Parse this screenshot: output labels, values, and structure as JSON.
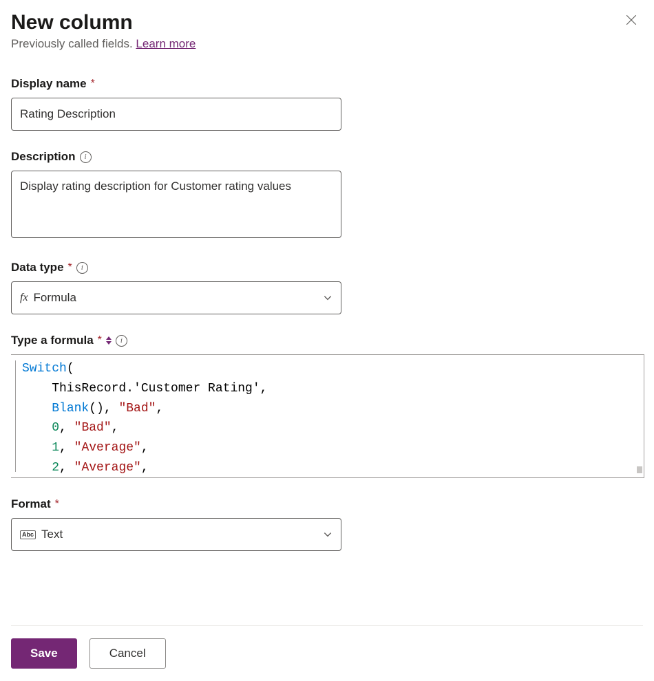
{
  "header": {
    "title": "New column",
    "subtitle_prefix": "Previously called fields. ",
    "learn_more": "Learn more"
  },
  "fields": {
    "display_name": {
      "label": "Display name",
      "value": "Rating Description"
    },
    "description": {
      "label": "Description",
      "value": "Display rating description for Customer rating values"
    },
    "data_type": {
      "label": "Data type",
      "icon": "fx",
      "value": "Formula"
    },
    "formula": {
      "label": "Type a formula",
      "code": [
        {
          "tokens": [
            {
              "cls": "tk-func",
              "t": "Switch"
            },
            {
              "cls": "tk-text",
              "t": "("
            }
          ]
        },
        {
          "tokens": [
            {
              "cls": "tk-text",
              "t": "    ThisRecord.'Customer Rating',"
            }
          ]
        },
        {
          "tokens": [
            {
              "cls": "tk-text",
              "t": "    "
            },
            {
              "cls": "tk-func",
              "t": "Blank"
            },
            {
              "cls": "tk-text",
              "t": "(), "
            },
            {
              "cls": "tk-str",
              "t": "\"Bad\""
            },
            {
              "cls": "tk-text",
              "t": ","
            }
          ]
        },
        {
          "tokens": [
            {
              "cls": "tk-text",
              "t": "    "
            },
            {
              "cls": "tk-num",
              "t": "0"
            },
            {
              "cls": "tk-text",
              "t": ", "
            },
            {
              "cls": "tk-str",
              "t": "\"Bad\""
            },
            {
              "cls": "tk-text",
              "t": ","
            }
          ]
        },
        {
          "tokens": [
            {
              "cls": "tk-text",
              "t": "    "
            },
            {
              "cls": "tk-num",
              "t": "1"
            },
            {
              "cls": "tk-text",
              "t": ", "
            },
            {
              "cls": "tk-str",
              "t": "\"Average\""
            },
            {
              "cls": "tk-text",
              "t": ","
            }
          ]
        },
        {
          "tokens": [
            {
              "cls": "tk-text",
              "t": "    "
            },
            {
              "cls": "tk-num",
              "t": "2"
            },
            {
              "cls": "tk-text",
              "t": ", "
            },
            {
              "cls": "tk-str",
              "t": "\"Average\""
            },
            {
              "cls": "tk-text",
              "t": ","
            }
          ]
        }
      ]
    },
    "format": {
      "label": "Format",
      "icon": "Abc",
      "value": "Text"
    }
  },
  "buttons": {
    "save": "Save",
    "cancel": "Cancel"
  }
}
